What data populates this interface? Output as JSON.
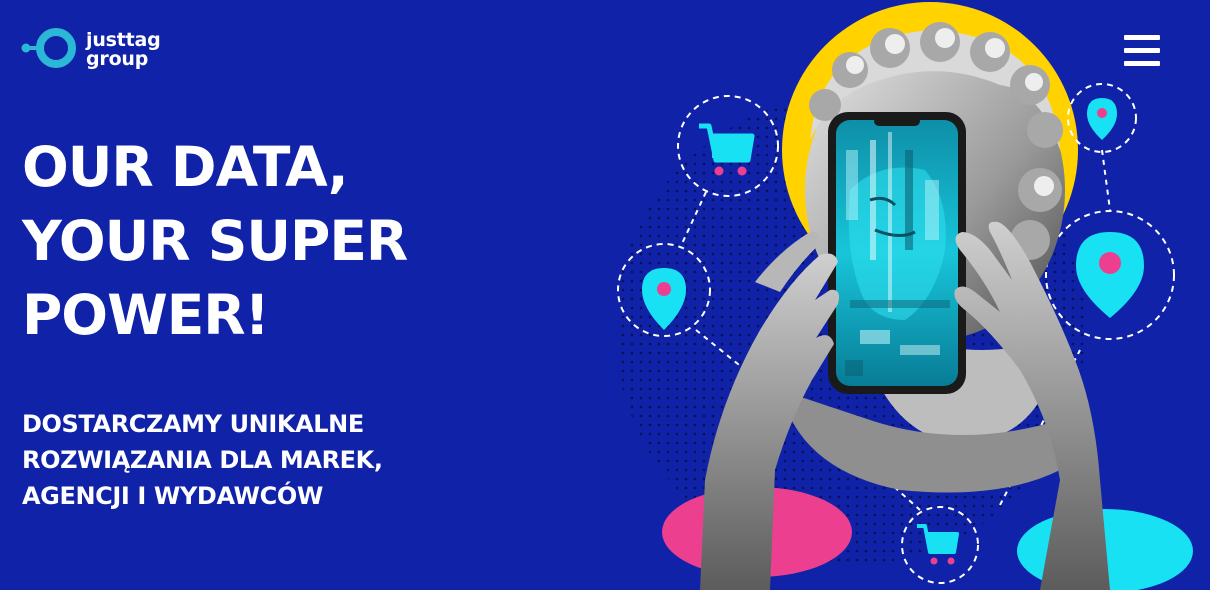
{
  "brand": {
    "name_line1": "justtag",
    "name_line2": "group",
    "accent_color": "#2bb8d6",
    "background_color": "#0f22a8"
  },
  "header": {
    "menu_icon": "hamburger-menu-icon"
  },
  "hero": {
    "headline": [
      "OUR DATA,",
      "YOUR SUPER",
      "POWER!"
    ],
    "subheadline": [
      "DOSTARCZAMY UNIKALNE",
      "ROZWIĄZANIA DLA MAREK,",
      "AGENCJI I WYDAWCÓW"
    ]
  },
  "illustration": {
    "icons": [
      "shopping-cart-icon",
      "location-pin-icon",
      "location-pin-icon",
      "location-pin-icon",
      "shopping-cart-icon"
    ],
    "colors": {
      "yellow": "#ffd200",
      "pink": "#ec3f8f",
      "cyan": "#19e1f4",
      "pin_dot": "#ec3f8f"
    }
  }
}
